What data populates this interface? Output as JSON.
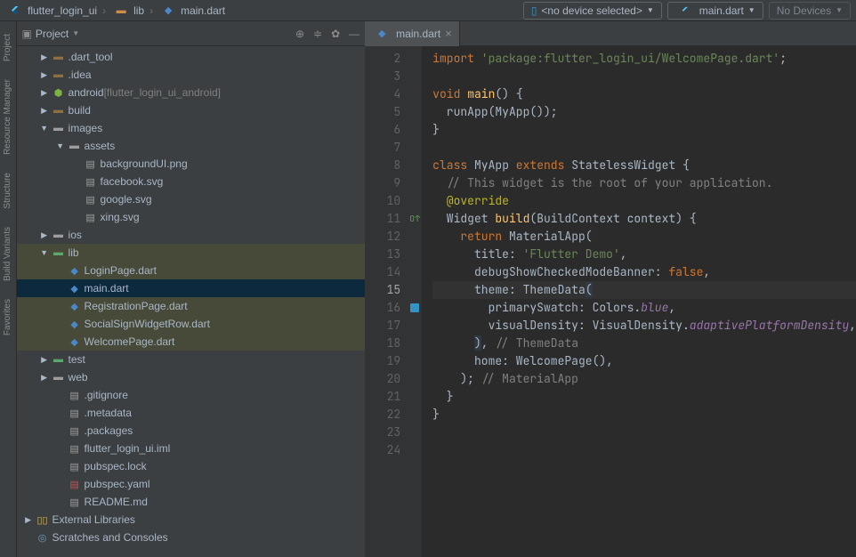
{
  "breadcrumbs": {
    "items": [
      {
        "label": "flutter_login_ui",
        "icon": "flutter"
      },
      {
        "label": "lib",
        "icon": "folder"
      },
      {
        "label": "main.dart",
        "icon": "dart"
      }
    ]
  },
  "toolbar": {
    "device_icon": "phone",
    "device_text": "<no device selected>",
    "config_text": "main.dart",
    "attach": "No Devices"
  },
  "left_tabs": [
    "Project",
    "Resource Manager",
    "Structure",
    "Build Variants",
    "Favorites"
  ],
  "project_panel": {
    "title": "Project",
    "tree": [
      {
        "depth": 0,
        "arrow": "right",
        "icon": "folder-excl",
        "label": ".dart_tool",
        "class": ""
      },
      {
        "depth": 0,
        "arrow": "right",
        "icon": "folder-excl",
        "label": ".idea",
        "class": ""
      },
      {
        "depth": 0,
        "arrow": "right",
        "icon": "folder-android",
        "label": "android",
        "suffix": "[flutter_login_ui_android]",
        "class": ""
      },
      {
        "depth": 0,
        "arrow": "right",
        "icon": "folder-excl",
        "label": "build",
        "class": ""
      },
      {
        "depth": 0,
        "arrow": "down",
        "icon": "folder-grey",
        "label": "images",
        "class": ""
      },
      {
        "depth": 1,
        "arrow": "down",
        "icon": "folder-grey",
        "label": "assets",
        "class": ""
      },
      {
        "depth": 2,
        "arrow": "",
        "icon": "file",
        "label": "backgroundUI.png",
        "class": ""
      },
      {
        "depth": 2,
        "arrow": "",
        "icon": "file",
        "label": "facebook.svg",
        "class": ""
      },
      {
        "depth": 2,
        "arrow": "",
        "icon": "file",
        "label": "google.svg",
        "class": ""
      },
      {
        "depth": 2,
        "arrow": "",
        "icon": "file",
        "label": "xing.svg",
        "class": ""
      },
      {
        "depth": 0,
        "arrow": "right",
        "icon": "folder-grey",
        "label": "ios",
        "class": ""
      },
      {
        "depth": 0,
        "arrow": "down",
        "icon": "folder-teal",
        "label": "lib",
        "class": "hl"
      },
      {
        "depth": 1,
        "arrow": "",
        "icon": "dart",
        "label": "LoginPage.dart",
        "class": "hl"
      },
      {
        "depth": 1,
        "arrow": "",
        "icon": "dart",
        "label": "main.dart",
        "class": "sel"
      },
      {
        "depth": 1,
        "arrow": "",
        "icon": "dart",
        "label": "RegistrationPage.dart",
        "class": "hl"
      },
      {
        "depth": 1,
        "arrow": "",
        "icon": "dart",
        "label": "SocialSignWidgetRow.dart",
        "class": "hl"
      },
      {
        "depth": 1,
        "arrow": "",
        "icon": "dart",
        "label": "WelcomePage.dart",
        "class": "hl"
      },
      {
        "depth": 0,
        "arrow": "right",
        "icon": "folder-teal",
        "label": "test",
        "class": ""
      },
      {
        "depth": 0,
        "arrow": "right",
        "icon": "folder-grey",
        "label": "web",
        "class": ""
      },
      {
        "depth": 1,
        "arrow": "",
        "icon": "file",
        "label": ".gitignore",
        "class": ""
      },
      {
        "depth": 1,
        "arrow": "",
        "icon": "file",
        "label": ".metadata",
        "class": ""
      },
      {
        "depth": 1,
        "arrow": "",
        "icon": "file",
        "label": ".packages",
        "class": ""
      },
      {
        "depth": 1,
        "arrow": "",
        "icon": "file",
        "label": "flutter_login_ui.iml",
        "class": ""
      },
      {
        "depth": 1,
        "arrow": "",
        "icon": "file",
        "label": "pubspec.lock",
        "class": ""
      },
      {
        "depth": 1,
        "arrow": "",
        "icon": "yaml",
        "label": "pubspec.yaml",
        "class": ""
      },
      {
        "depth": 1,
        "arrow": "",
        "icon": "file",
        "label": "README.md",
        "class": ""
      },
      {
        "depth": -1,
        "arrow": "right",
        "icon": "lib",
        "label": "External Libraries",
        "class": ""
      },
      {
        "depth": -1,
        "arrow": "",
        "icon": "scratch",
        "label": "Scratches and Consoles",
        "class": ""
      }
    ]
  },
  "editor": {
    "tab": "main.dart",
    "lines": [
      2,
      3,
      4,
      5,
      6,
      7,
      8,
      9,
      10,
      11,
      12,
      13,
      14,
      15,
      16,
      17,
      18,
      19,
      20,
      21,
      22,
      23,
      24
    ],
    "current_line": 15,
    "code": [
      {
        "n": 2,
        "html": "<span class='kw'>import</span> <span class='str'>'package:flutter_login_ui/WelcomePage.dart'</span>;"
      },
      {
        "n": 3,
        "html": ""
      },
      {
        "n": 4,
        "html": "<span class='kw'>void</span> <span class='fn'>main</span>() {"
      },
      {
        "n": 5,
        "html": "  runApp(MyApp());"
      },
      {
        "n": 6,
        "html": "}"
      },
      {
        "n": 7,
        "html": ""
      },
      {
        "n": 8,
        "html": "<span class='kw'>class</span> MyApp <span class='kw'>extends</span> StatelessWidget {"
      },
      {
        "n": 9,
        "html": "  <span class='com'>// This widget is the root of your application.</span>"
      },
      {
        "n": 10,
        "html": "  <span class='anno'>@override</span>"
      },
      {
        "n": 11,
        "html": "  Widget <span class='fn'>build</span>(BuildContext context) {"
      },
      {
        "n": 12,
        "html": "    <span class='kw'>return</span> MaterialApp("
      },
      {
        "n": 13,
        "html": "      title: <span class='str'>'Flutter Demo'</span>,"
      },
      {
        "n": 14,
        "html": "      debugShowCheckedModeBanner: <span class='kw'>false</span>,"
      },
      {
        "n": 15,
        "html": "      theme: ThemeData<span class='hi-blue'>(</span>"
      },
      {
        "n": 16,
        "html": "        primarySwatch: Colors.<span class='field'>blue</span>,"
      },
      {
        "n": 17,
        "html": "        visualDensity: VisualDensity.<span class='field'>adaptivePlatformDensity</span>,"
      },
      {
        "n": 18,
        "html": "      <span class='hi-blue'>)</span>, <span class='com'>// ThemeData</span>"
      },
      {
        "n": 19,
        "html": "      home: WelcomePage(),"
      },
      {
        "n": 20,
        "html": "    ); <span class='com'>// MaterialApp</span>"
      },
      {
        "n": 21,
        "html": "  }"
      },
      {
        "n": 22,
        "html": "}"
      },
      {
        "n": 23,
        "html": ""
      },
      {
        "n": 24,
        "html": ""
      }
    ]
  }
}
